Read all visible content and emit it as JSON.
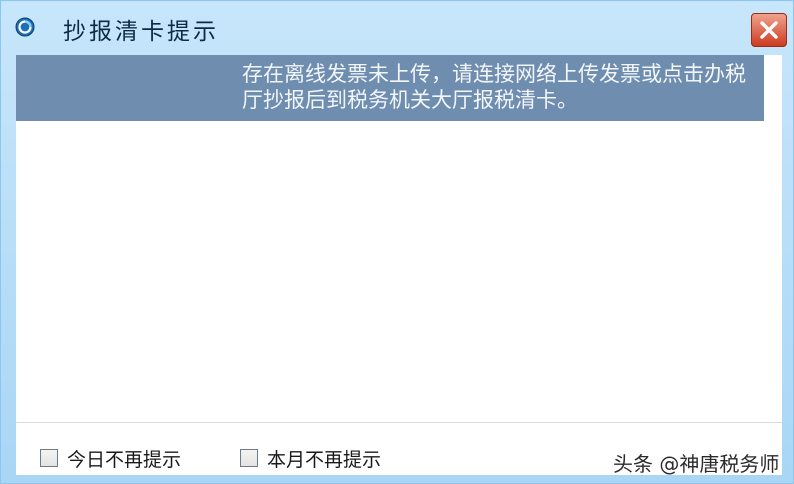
{
  "window": {
    "title": "抄报清卡提示",
    "app_icon": "circular-app-icon",
    "close_icon": "close-x-icon",
    "colors": {
      "frame": "#a9d6f5",
      "message_bar": "#6f8daf",
      "close": "#cc3b20"
    }
  },
  "message": {
    "text": "存在离线发票未上传，请连接网络上传发票或点击办税厅抄报后到税务机关大厅报税清卡。"
  },
  "footer": {
    "checkbox_today": {
      "label": "今日不再提示",
      "checked": false
    },
    "checkbox_month": {
      "label": "本月不再提示",
      "checked": false
    }
  },
  "watermark": {
    "text": "头条 @神唐税务师"
  }
}
